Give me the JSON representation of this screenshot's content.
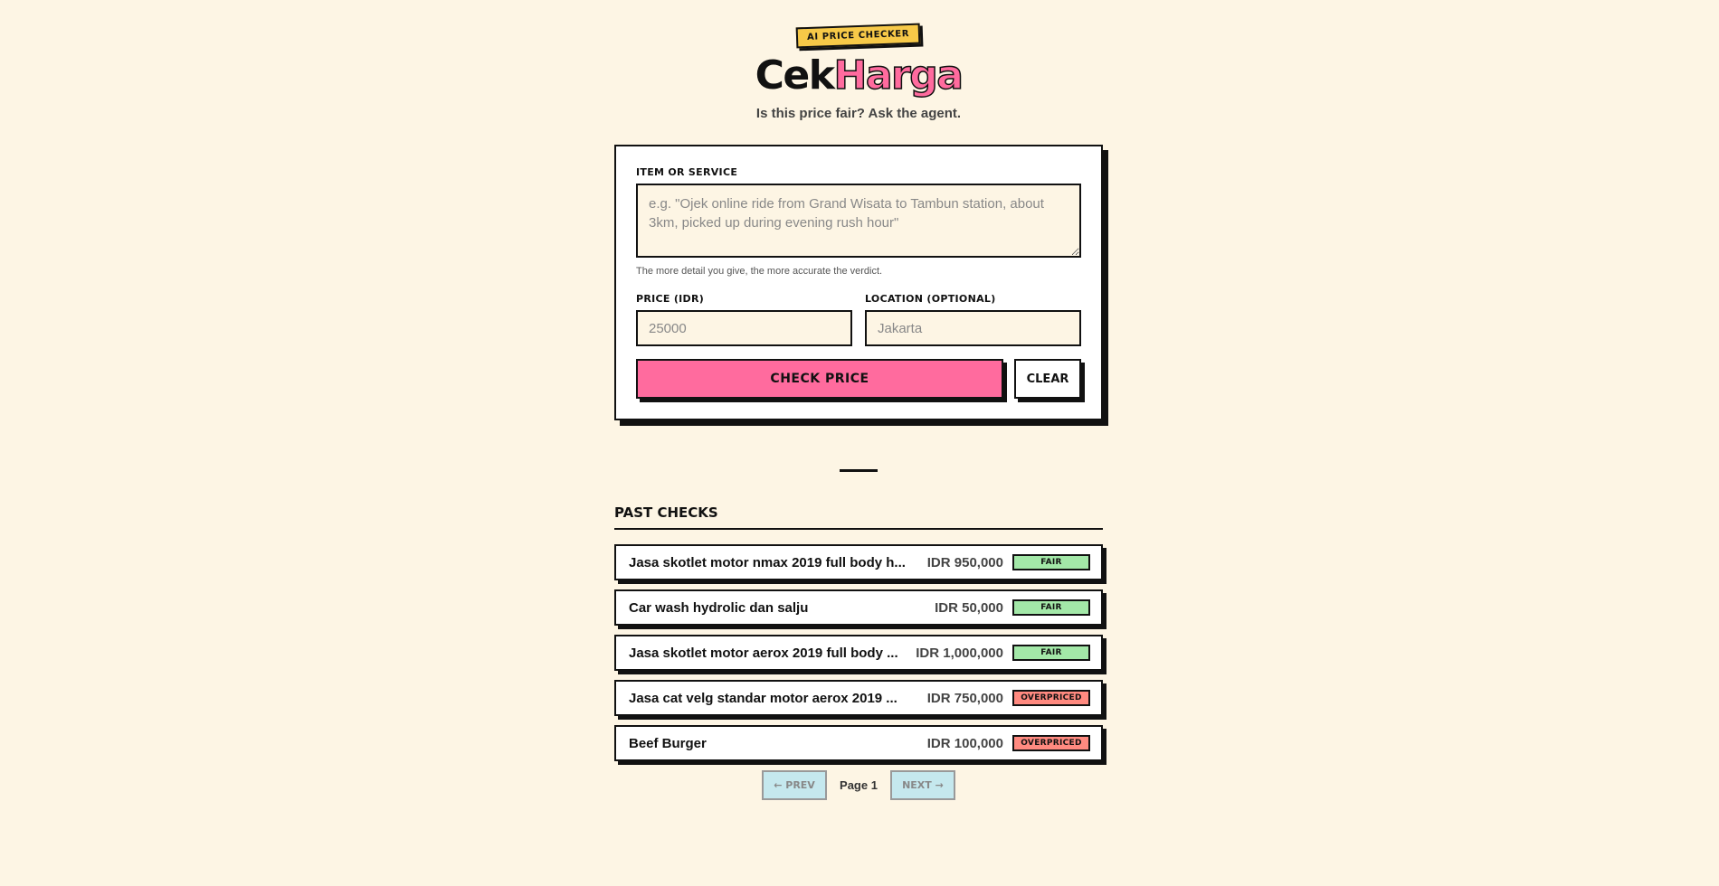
{
  "header": {
    "badge": "AI PRICE CHECKER",
    "title_part1": "Cek",
    "title_part2": "Harga",
    "subtitle": "Is this price fair? Ask the agent."
  },
  "form": {
    "item_label": "ITEM OR SERVICE",
    "item_placeholder": "e.g. \"Ojek online ride from Grand Wisata to Tambun station, about 3km, picked up during evening rush hour\"",
    "item_value": "",
    "hint": "The more detail you give, the more accurate the verdict.",
    "price_label": "PRICE (IDR)",
    "price_placeholder": "25000",
    "price_value": "",
    "location_label": "LOCATION (OPTIONAL)",
    "location_placeholder": "Jakarta",
    "location_value": "",
    "check_button": "CHECK PRICE",
    "clear_button": "CLEAR"
  },
  "past_checks": {
    "title": "PAST CHECKS",
    "items": [
      {
        "name": "Jasa skotlet motor nmax 2019 full body h...",
        "price": "IDR 950,000",
        "verdict": "FAIR"
      },
      {
        "name": "Car wash hydrolic dan salju",
        "price": "IDR 50,000",
        "verdict": "FAIR"
      },
      {
        "name": "Jasa skotlet motor aerox 2019 full body ...",
        "price": "IDR 1,000,000",
        "verdict": "FAIR"
      },
      {
        "name": "Jasa cat velg standar motor aerox 2019 ...",
        "price": "IDR 750,000",
        "verdict": "OVERPRICED"
      },
      {
        "name": "Beef Burger",
        "price": "IDR 100,000",
        "verdict": "OVERPRICED"
      }
    ]
  },
  "pagination": {
    "prev": "← PREV",
    "page": "Page 1",
    "next": "NEXT →"
  },
  "colors": {
    "background": "#fdf5e4",
    "accent_pink": "#ff6b9e",
    "badge_yellow": "#f7c948",
    "fair_green": "#a3e8a8",
    "overpriced_red": "#ff8a80"
  }
}
